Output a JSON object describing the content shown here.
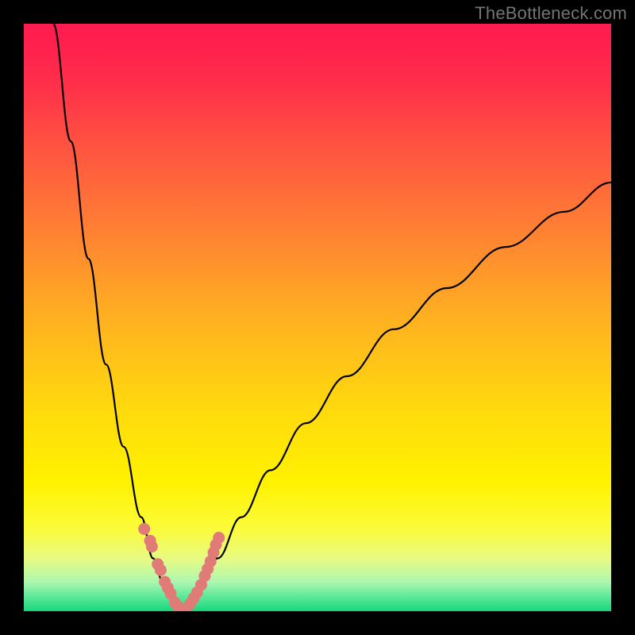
{
  "watermark": "TheBottleneck.com",
  "chart_data": {
    "type": "line",
    "title": "",
    "xlabel": "",
    "ylabel": "",
    "xlim": [
      0,
      100
    ],
    "ylim": [
      0,
      100
    ],
    "grid": false,
    "legend": false,
    "series": [
      {
        "name": "left-curve",
        "x": [
          5,
          8,
          11,
          14,
          17,
          20,
          22,
          24,
          25.5,
          26.5,
          27
        ],
        "y": [
          100,
          80,
          60,
          42,
          28,
          16,
          9,
          4,
          1.5,
          0.3,
          0
        ]
      },
      {
        "name": "right-curve",
        "x": [
          27,
          28,
          30,
          33,
          37,
          42,
          48,
          55,
          63,
          72,
          82,
          92,
          100
        ],
        "y": [
          0,
          1,
          4,
          9,
          16,
          24,
          32,
          40,
          48,
          55,
          62,
          68,
          73
        ]
      }
    ],
    "markers": {
      "name": "data-points",
      "color": "#e07b78",
      "x": [
        20.5,
        21.5,
        21.8,
        22.8,
        23.3,
        24.0,
        24.5,
        25.0,
        25.7,
        26.2,
        26.8,
        27.5,
        28.3,
        28.9,
        29.5,
        30.2,
        30.8,
        31.3,
        31.8,
        32.3,
        32.7,
        33.2
      ],
      "y": [
        14.0,
        12.0,
        11.0,
        8.0,
        7.0,
        5.0,
        4.0,
        3.0,
        1.5,
        0.8,
        0.3,
        0.3,
        1.2,
        2.2,
        3.2,
        4.5,
        6.0,
        7.2,
        8.5,
        10.0,
        11.3,
        12.5
      ]
    },
    "background_gradient_stops": [
      {
        "offset": 0.0,
        "color": "#ff1a4f"
      },
      {
        "offset": 0.1,
        "color": "#ff2e4a"
      },
      {
        "offset": 0.22,
        "color": "#ff5740"
      },
      {
        "offset": 0.35,
        "color": "#ff8033"
      },
      {
        "offset": 0.5,
        "color": "#ffb021"
      },
      {
        "offset": 0.65,
        "color": "#ffd80e"
      },
      {
        "offset": 0.78,
        "color": "#fff200"
      },
      {
        "offset": 0.86,
        "color": "#fbfb3a"
      },
      {
        "offset": 0.91,
        "color": "#e8fb82"
      },
      {
        "offset": 0.95,
        "color": "#aef7b0"
      },
      {
        "offset": 0.975,
        "color": "#5de99a"
      },
      {
        "offset": 1.0,
        "color": "#18d67b"
      }
    ]
  }
}
